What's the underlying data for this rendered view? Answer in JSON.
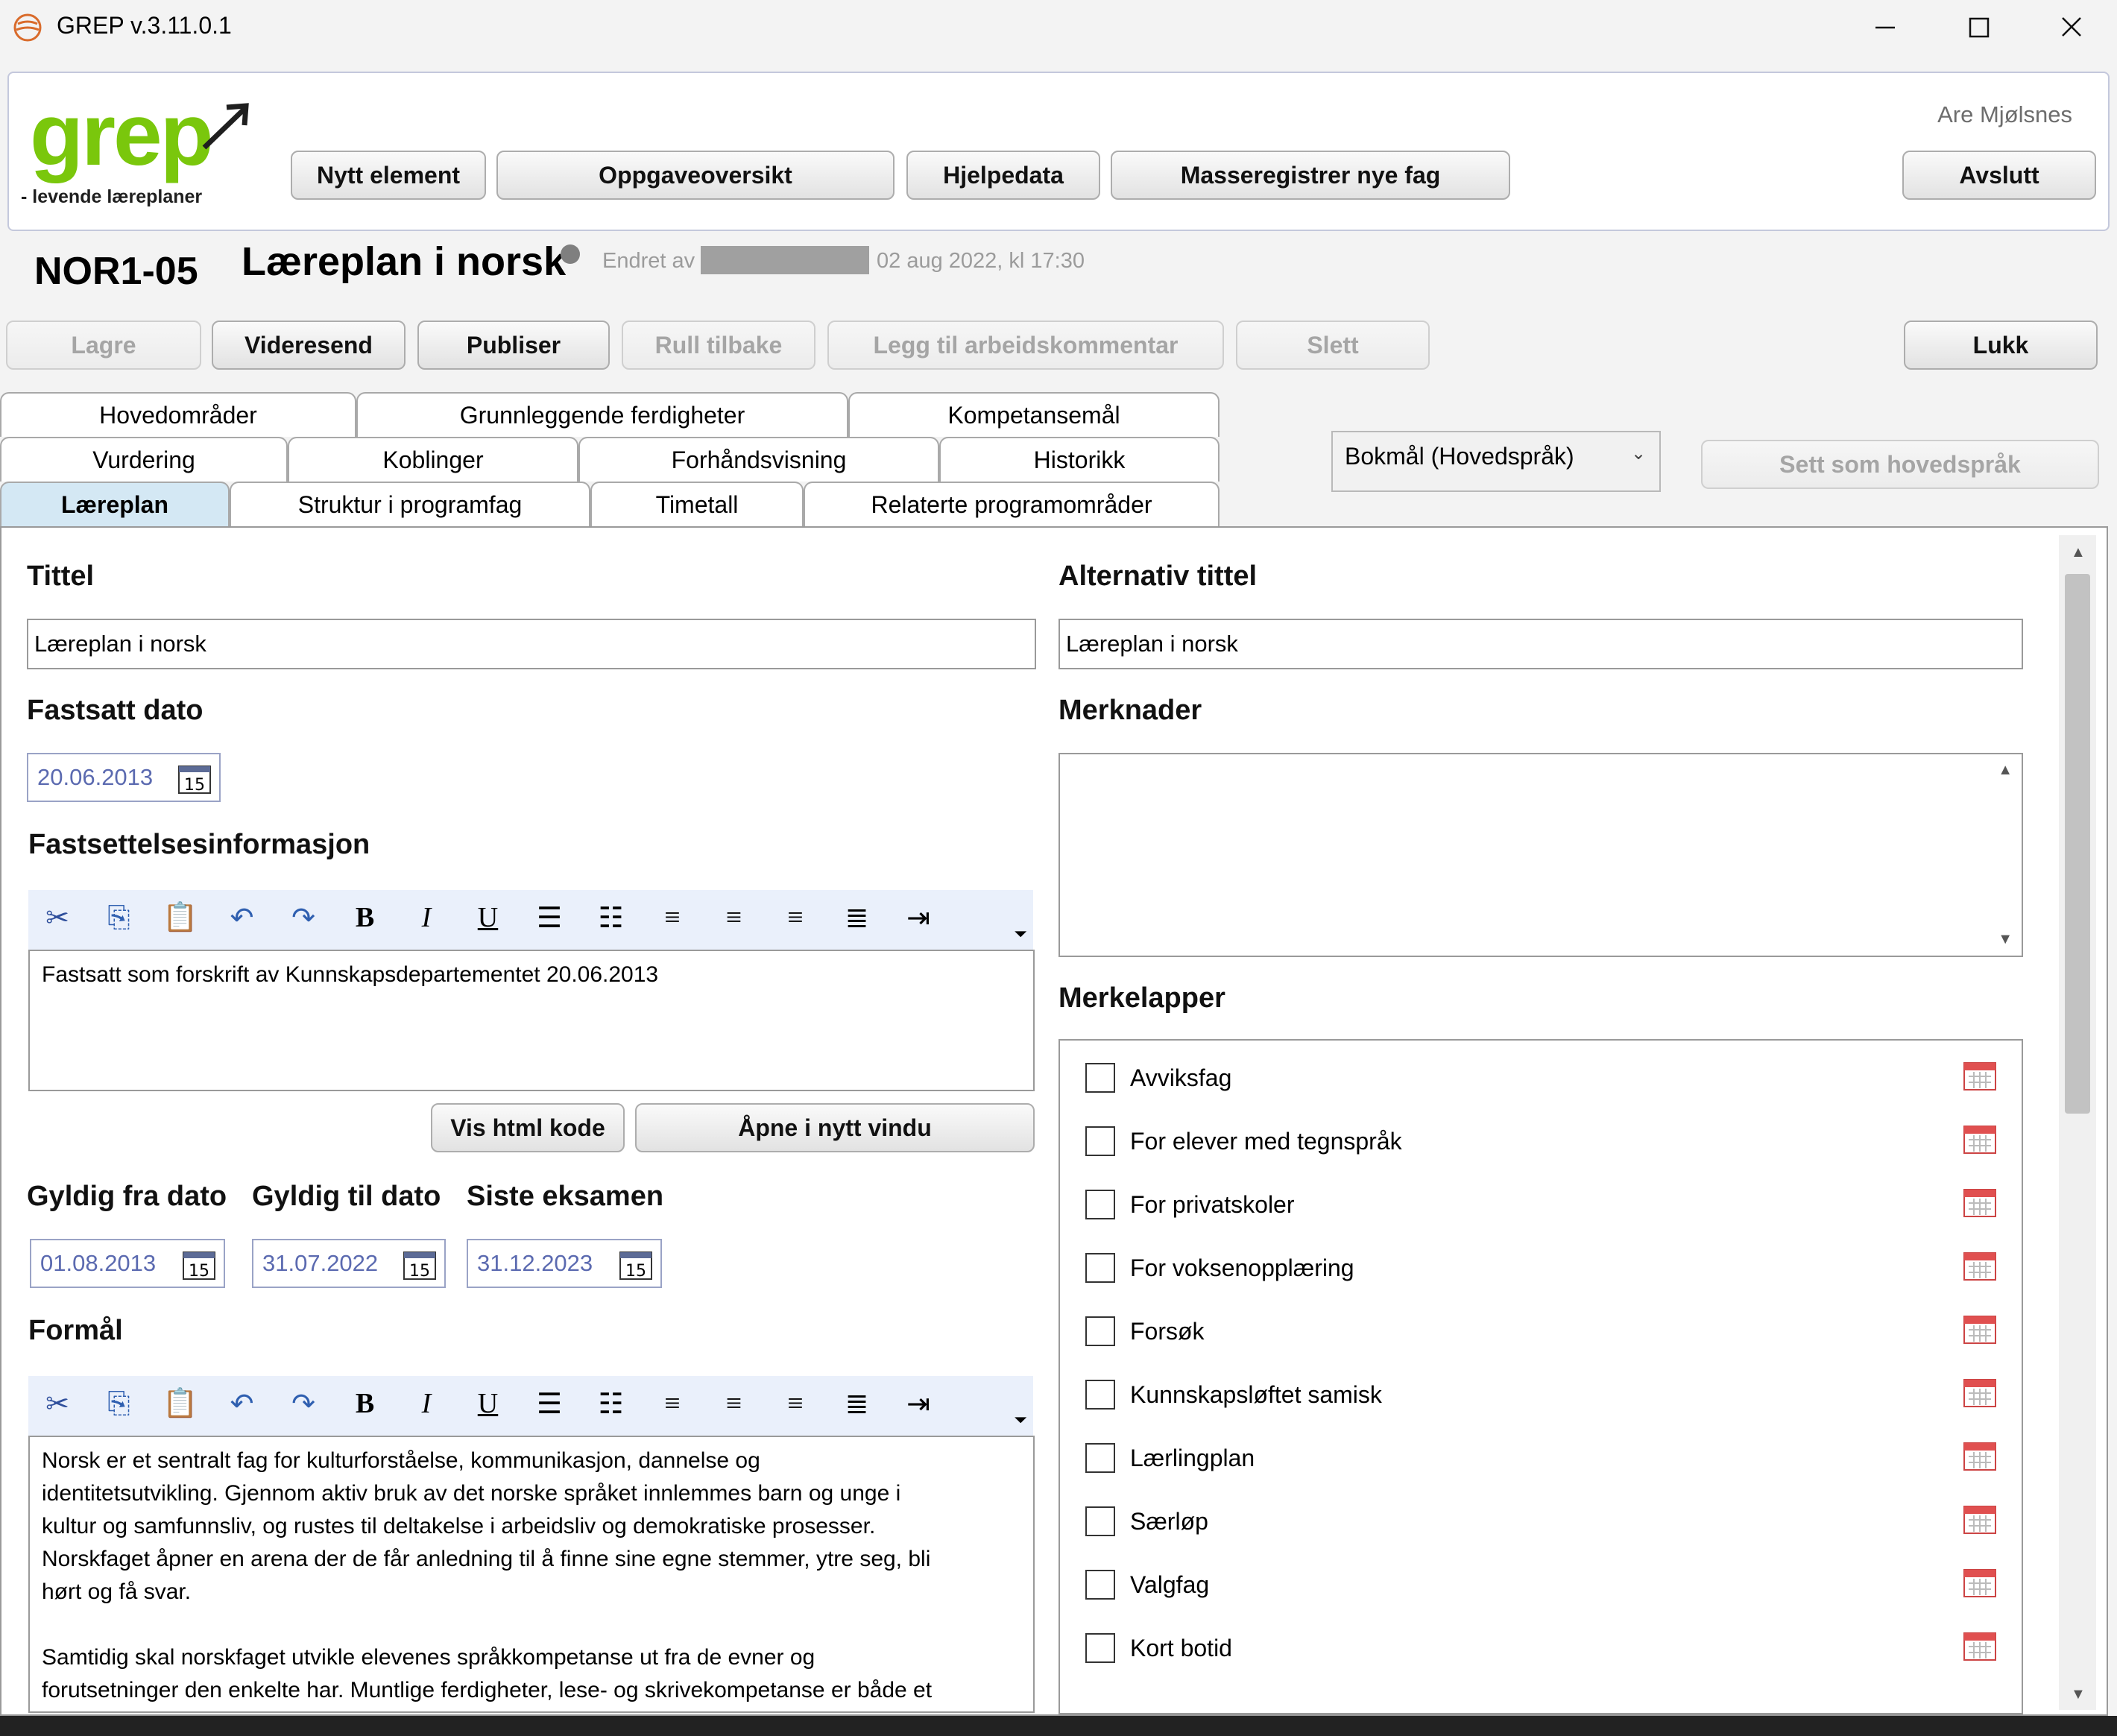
{
  "window": {
    "title": "GREP v.3.11.0.1",
    "controls": [
      "minimize-icon",
      "maximize-icon",
      "close-icon"
    ]
  },
  "header": {
    "logo_word": "grep",
    "logo_tagline": "- levende læreplaner",
    "user": "Are Mjølsnes",
    "buttons": {
      "new_element": "Nytt element",
      "task_overview": "Oppgaveoversikt",
      "help_data": "Hjelpedata",
      "mass_register": "Masseregistrer nye fag",
      "exit": "Avslutt"
    }
  },
  "element": {
    "code": "NOR1-05",
    "title": "Læreplan i norsk",
    "changed_by_label": "Endret av",
    "changed_date": "02 aug 2022, kl 17:30"
  },
  "actions": {
    "save": "Lagre",
    "forward": "Videresend",
    "publish": "Publiser",
    "rollback": "Rull tilbake",
    "add_comment": "Legg til arbeidskommentar",
    "delete": "Slett",
    "close": "Lukk"
  },
  "tabs": {
    "row1": [
      "Hovedområder",
      "Grunnleggende ferdigheter",
      "Kompetansemål"
    ],
    "row2": [
      "Vurdering",
      "Koblinger",
      "Forhåndsvisning",
      "Historikk"
    ],
    "row3": [
      "Læreplan",
      "Struktur i programfag",
      "Timetall",
      "Relaterte programområder"
    ],
    "active": "Læreplan"
  },
  "language": {
    "selected": "Bokmål (Hovedspråk)",
    "set_main_button": "Sett som hovedspråk"
  },
  "form": {
    "title_label": "Tittel",
    "title_value": "Læreplan i norsk",
    "alt_title_label": "Alternativ tittel",
    "alt_title_value": "Læreplan i norsk",
    "set_date_label": "Fastsatt dato",
    "set_date_value": "20.06.2013",
    "remarks_label": "Merknader",
    "set_info_label": "Fastsettelsesinformasjon",
    "set_info_text": "Fastsatt som forskrift av Kunnskapsdepartementet 20.06.2013",
    "show_html_button": "Vis html kode",
    "open_new_window_button": "Åpne i nytt vindu",
    "valid_from_label": "Gyldig fra dato",
    "valid_from_value": "01.08.2013",
    "valid_to_label": "Gyldig til dato",
    "valid_to_value": "31.07.2022",
    "last_exam_label": "Siste eksamen",
    "last_exam_value": "31.12.2023",
    "purpose_label": "Formål",
    "purpose_text": "Norsk er et sentralt fag for kulturforståelse, kommunikasjon, dannelse og\nidentitetsutvikling. Gjennom aktiv bruk av det norske språket innlemmes barn og unge i\nkultur og samfunnsliv, og rustes til deltakelse i arbeidsliv og demokratiske prosesser.\nNorskfaget åpner en arena der de får anledning til å finne sine egne stemmer, ytre seg, bli\nhørt og få svar.\n\nSamtidig skal norskfaget utvikle elevenes språkkompetanse ut fra de evner og\nforutsetninger den enkelte har. Muntlige ferdigheter, lese- og skrivekompetanse er både et",
    "calendar_icon_day": "15",
    "tags_label": "Merkelapper",
    "tags": [
      "Avviksfag",
      "For elever med tegnspråk",
      "For privatskoler",
      "For voksenopplæring",
      "Forsøk",
      "Kunnskapsløftet samisk",
      "Lærlingplan",
      "Særløp",
      "Valgfag",
      "Kort botid"
    ]
  },
  "toolbar_icons": [
    "cut-icon",
    "copy-icon",
    "paste-icon",
    "undo-icon",
    "redo-icon",
    "bold-icon",
    "italic-icon",
    "underline-icon",
    "bullet-list-icon",
    "numbered-list-icon",
    "align-left-icon",
    "align-center-icon",
    "align-right-icon",
    "justify-icon",
    "indent-icon"
  ],
  "colors": {
    "logo_green": "#7ac70c",
    "active_tab": "#d4e8f4",
    "date_text": "#5b6ab0",
    "calendar_red": "#e05050"
  }
}
